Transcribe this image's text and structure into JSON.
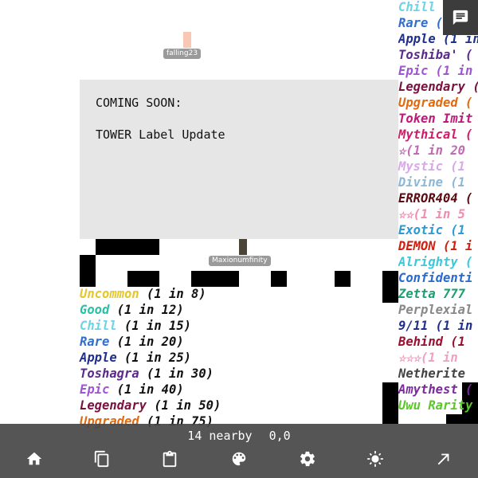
{
  "notice": {
    "line1": "COMING SOON:",
    "line2": "TOWER Label Update"
  },
  "players": [
    {
      "name": "falling23",
      "color": "#f8c8b4"
    },
    {
      "name": "Maxionumfinity",
      "color": "#4a4536"
    }
  ],
  "left_rarities": [
    {
      "name": "Uncommon",
      "odds": "(1 in 8)",
      "color": "#e5c62b"
    },
    {
      "name": "Good",
      "odds": "(1 in 12)",
      "color": "#2bbfa6"
    },
    {
      "name": "Chill",
      "odds": "(1 in 15)",
      "color": "#6fd3e8"
    },
    {
      "name": "Rare",
      "odds": "(1 in 20)",
      "color": "#2f6fcf"
    },
    {
      "name": "Apple",
      "odds": "(1 in 25)",
      "color": "#1f2f8c"
    },
    {
      "name": "Toshagra",
      "odds": "(1 in 30)",
      "color": "#5b2a8a"
    },
    {
      "name": "Epic",
      "odds": "(1 in 40)",
      "color": "#a055d0"
    },
    {
      "name": "Legendary",
      "odds": "(1 in 50)",
      "color": "#7a1140"
    },
    {
      "name": "Upgraded",
      "odds": "(1 in 75)",
      "color": "#e06a10"
    }
  ],
  "right_rarities": [
    {
      "text": "Chill (",
      "color": "#6fd3e8"
    },
    {
      "text": "Rare (1 in",
      "color": "#2f6fcf"
    },
    {
      "text": "Apple (1 in",
      "color": "#1f2f8c"
    },
    {
      "text": "Toshiba' (",
      "color": "#5b2a8a"
    },
    {
      "text": "Epic (1 in",
      "color": "#a055d0"
    },
    {
      "text": "Legendary (",
      "color": "#7a1140"
    },
    {
      "text": "Upgraded (",
      "color": "#e06a10"
    },
    {
      "text": "Token Imit",
      "color": "#c0187a"
    },
    {
      "text": "Mythical (",
      "color": "#d01f6a"
    },
    {
      "text": "☆(1 in 20",
      "color": "#c06ab0"
    },
    {
      "text": "Mystic (1",
      "color": "#d8a8e8"
    },
    {
      "text": "Divine (1",
      "color": "#8cb8d8"
    },
    {
      "text": "ERROR404 (",
      "color": "#5a0a10"
    },
    {
      "text": "☆☆(1 in 5",
      "color": "#f08cb0"
    },
    {
      "text": "Exotic (1",
      "color": "#2a9ad8"
    },
    {
      "text": "DEMON (1 i",
      "color": "#d02010"
    },
    {
      "text": "Alrighty (",
      "color": "#3cc8d8"
    },
    {
      "text": "Confidenti",
      "color": "#2a6ad0"
    },
    {
      "text": "Zetta 777",
      "color": "#1aa070"
    },
    {
      "text": "Perplexial",
      "color": "#888888"
    },
    {
      "text": "9/11 (1 in",
      "color": "#1f2f8c"
    },
    {
      "text": "Behind (1",
      "color": "#9a1030"
    },
    {
      "text": "☆☆☆(1 in",
      "color": "#f0a0c0"
    },
    {
      "text": "Netherite",
      "color": "#444444"
    },
    {
      "text": "Amythest (",
      "color": "#7a2a9a"
    },
    {
      "text": "Uwu Rarity",
      "color": "#5ac82a"
    }
  ],
  "status": {
    "nearby": "14 nearby",
    "coords": "0,0"
  },
  "toolbar": [
    {
      "icon": "home-icon"
    },
    {
      "icon": "copy-icon"
    },
    {
      "icon": "clipboard-icon"
    },
    {
      "icon": "palette-icon"
    },
    {
      "icon": "gear-icon"
    },
    {
      "icon": "brightness-icon"
    },
    {
      "icon": "expand-arrow-icon"
    }
  ]
}
